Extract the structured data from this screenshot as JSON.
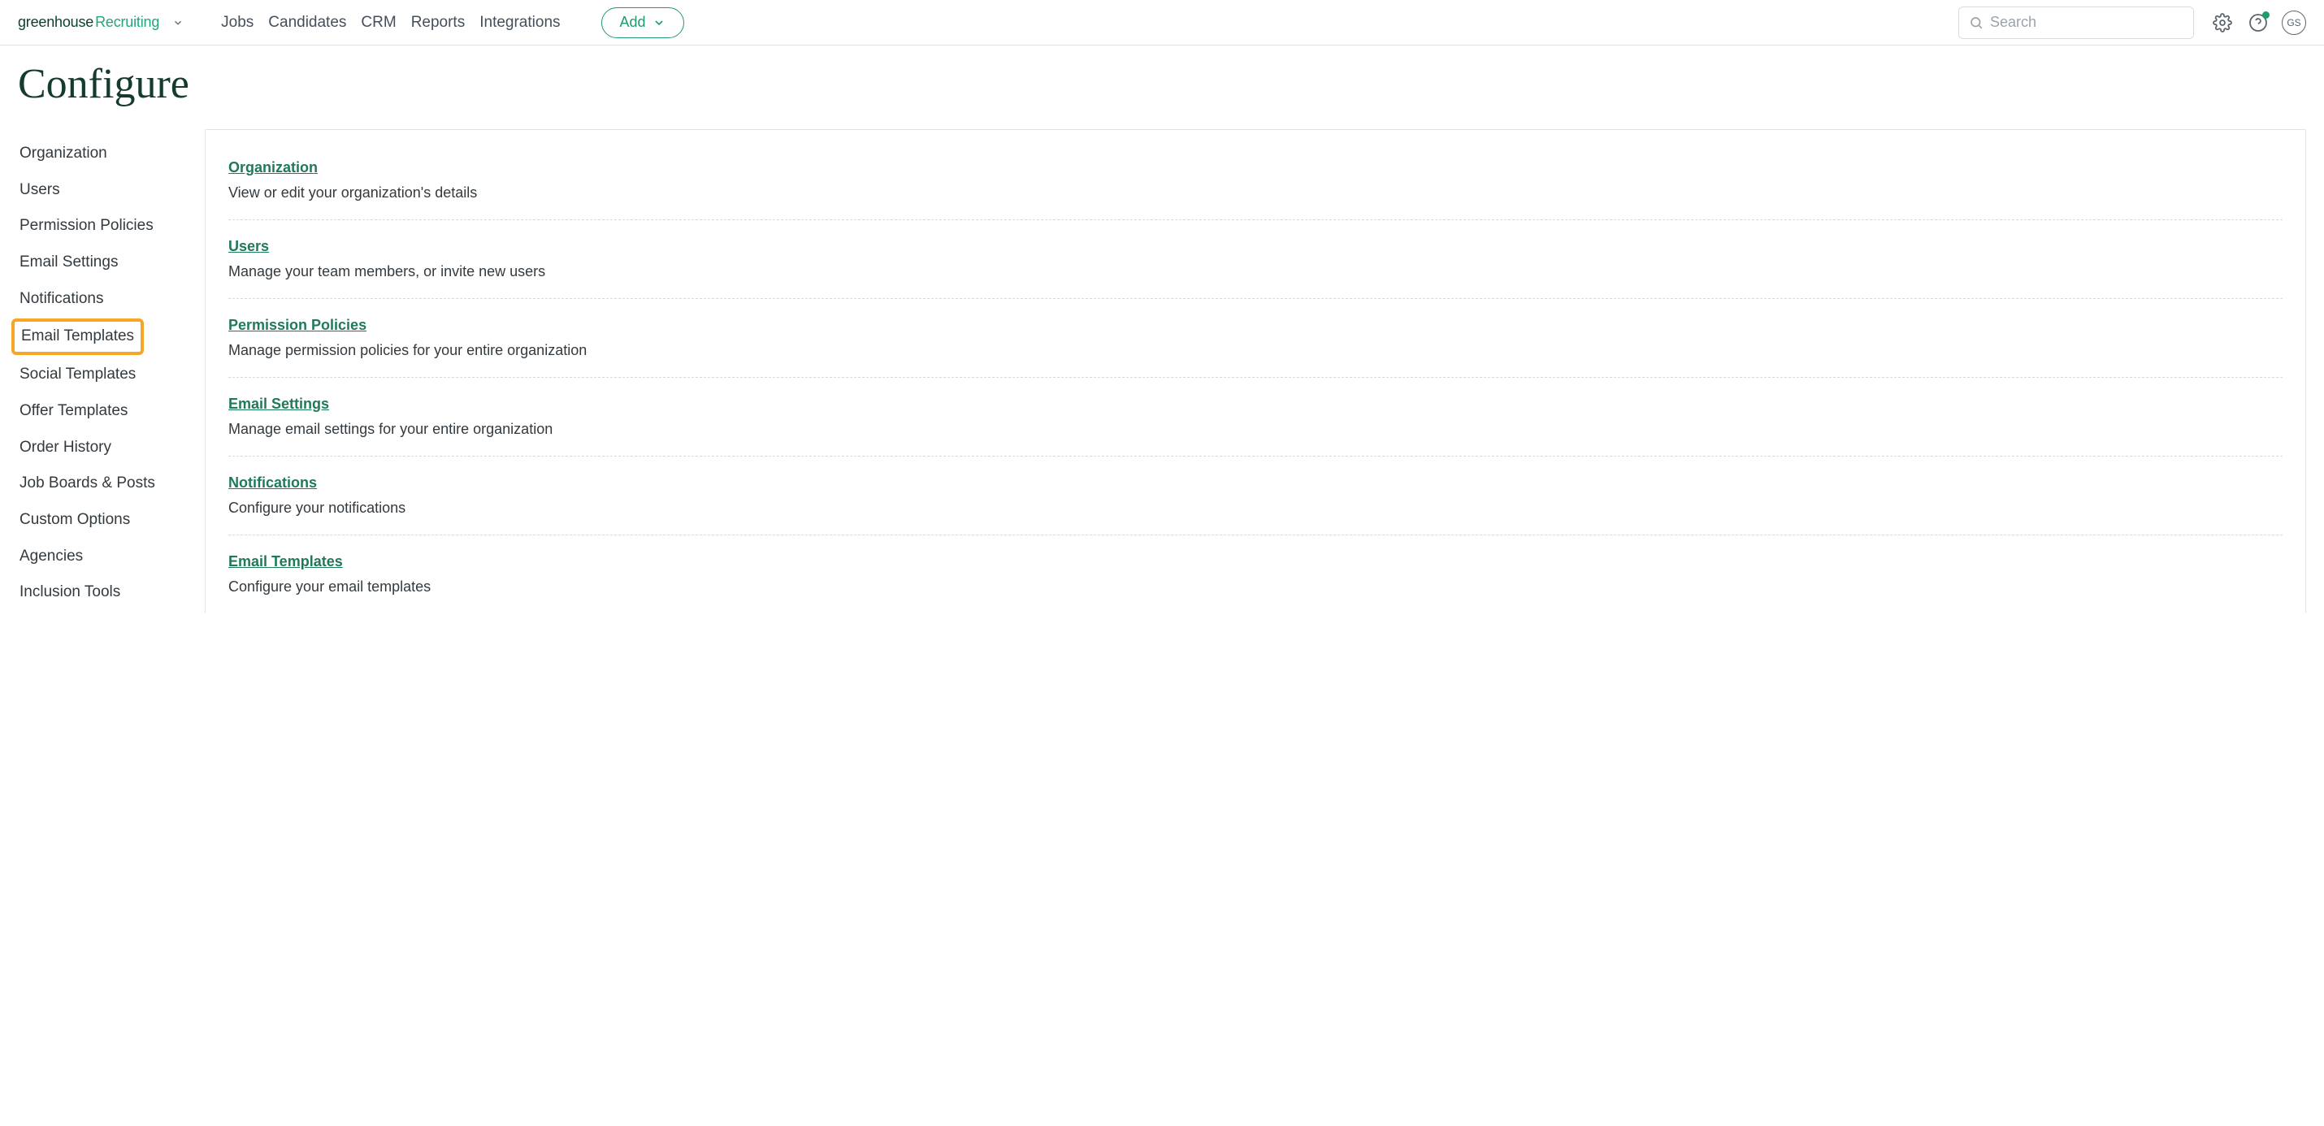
{
  "brand": {
    "part1": "greenhouse",
    "part2": "Recruiting"
  },
  "nav": {
    "items": [
      {
        "label": "Jobs"
      },
      {
        "label": "Candidates"
      },
      {
        "label": "CRM"
      },
      {
        "label": "Reports"
      },
      {
        "label": "Integrations"
      }
    ],
    "add_label": "Add"
  },
  "search": {
    "placeholder": "Search"
  },
  "user": {
    "initials": "GS"
  },
  "page": {
    "title": "Configure"
  },
  "sidebar": {
    "items": [
      {
        "label": "Organization",
        "highlighted": false
      },
      {
        "label": "Users",
        "highlighted": false
      },
      {
        "label": "Permission Policies",
        "highlighted": false
      },
      {
        "label": "Email Settings",
        "highlighted": false
      },
      {
        "label": "Notifications",
        "highlighted": false
      },
      {
        "label": "Email Templates",
        "highlighted": true
      },
      {
        "label": "Social Templates",
        "highlighted": false
      },
      {
        "label": "Offer Templates",
        "highlighted": false
      },
      {
        "label": "Order History",
        "highlighted": false
      },
      {
        "label": "Job Boards & Posts",
        "highlighted": false
      },
      {
        "label": "Custom Options",
        "highlighted": false
      },
      {
        "label": "Agencies",
        "highlighted": false
      },
      {
        "label": "Inclusion Tools",
        "highlighted": false
      }
    ]
  },
  "sections": [
    {
      "title": "Organization",
      "desc": "View or edit your organization's details"
    },
    {
      "title": "Users",
      "desc": "Manage your team members, or invite new users"
    },
    {
      "title": "Permission Policies",
      "desc": "Manage permission policies for your entire organization"
    },
    {
      "title": "Email Settings",
      "desc": "Manage email settings for your entire organization"
    },
    {
      "title": "Notifications",
      "desc": "Configure your notifications"
    },
    {
      "title": "Email Templates",
      "desc": "Configure your email templates"
    }
  ]
}
